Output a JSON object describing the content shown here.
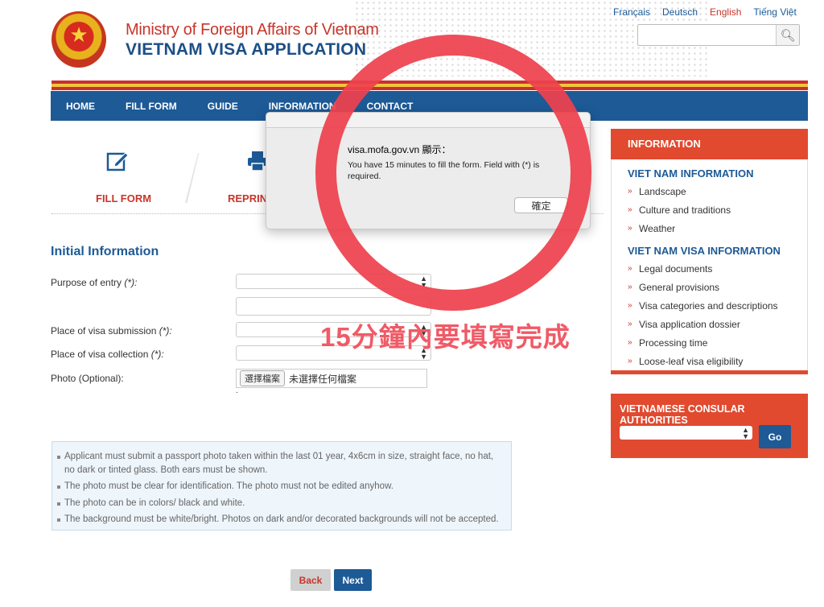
{
  "header": {
    "ministry": "Ministry of Foreign Affairs of Vietnam",
    "title": "VIETNAM VISA APPLICATION"
  },
  "languages": [
    {
      "label": "Français"
    },
    {
      "label": "Deutsch"
    },
    {
      "label": "English",
      "active": true
    },
    {
      "label": "Tiếng Việt"
    }
  ],
  "search": {
    "placeholder": "",
    "value": ""
  },
  "nav": {
    "items": [
      "HOME",
      "FILL FORM",
      "GUIDE",
      "INFORMATION",
      "CONTACT"
    ]
  },
  "steps": {
    "fill_form": "FILL FORM",
    "reprint": "REPRINT"
  },
  "form": {
    "section_title": "Initial Information",
    "purpose_label": "Purpose of entry",
    "submission_label": "Place of visa submission",
    "collection_label": "Place of visa collection",
    "required_mark": "(*):",
    "photo_label": "Photo (Optional):",
    "file_button": "選擇檔案",
    "file_status": "未選擇任何檔案",
    "file_hint": "."
  },
  "notes": [
    "Applicant must submit a passport photo taken within the last 01 year, 4x6cm in size, straight face, no hat, no dark or tinted glass. Both ears must be shown.",
    "The photo must be clear for identification. The photo must not be edited anyhow.",
    "The photo can be in colors/ black and white.",
    "The background must be white/bright. Photos on dark and/or decorated backgrounds will not be accepted."
  ],
  "buttons": {
    "back": "Back",
    "next": "Next"
  },
  "sidebar": {
    "header": "INFORMATION",
    "section1": "VIET NAM INFORMATION",
    "items1": [
      "Landscape",
      "Culture and traditions",
      "Weather"
    ],
    "section2": "VIET NAM VISA INFORMATION",
    "items2": [
      "Legal documents",
      "General provisions",
      "Visa categories and descriptions",
      "Visa application dossier",
      "Processing time",
      "Loose-leaf visa eligibility"
    ]
  },
  "consular": {
    "title": "VIETNAMESE CONSULAR AUTHORITIES",
    "go": "Go"
  },
  "dialog": {
    "title": "visa.mofa.gov.vn 顯示：",
    "message": "You have 15 minutes to fill the form. Field with (*) is required.",
    "ok": "確定"
  },
  "annotation": {
    "text": "15分鐘內要填寫完成"
  },
  "colors": {
    "brand_blue": "#1d5a96",
    "brand_red": "#c8352a",
    "sidebar_red": "#e14a2f",
    "annotation_red": "#ee424e"
  },
  "icons": {
    "fill_form": "edit-icon",
    "reprint": "printer-icon",
    "search": "search-icon",
    "emblem": "national-emblem-icon"
  }
}
